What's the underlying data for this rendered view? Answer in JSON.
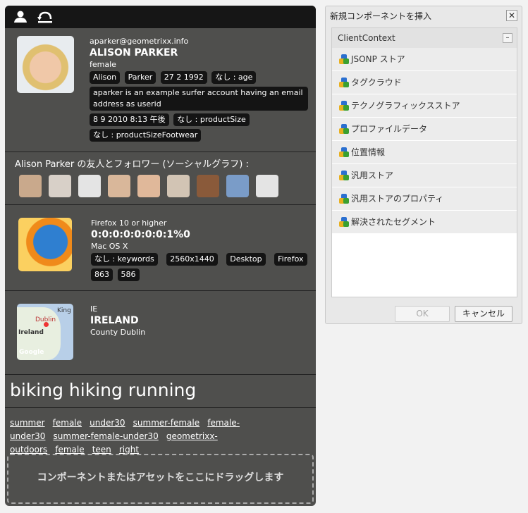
{
  "toolbar": {
    "icons": [
      "user-icon",
      "undo-icon"
    ]
  },
  "profile": {
    "email": "aparker@geometrixx.info",
    "name": "ALISON PARKER",
    "gender": "female",
    "chips": [
      "Alison",
      "Parker",
      "27 2 1992",
      "なし : age"
    ],
    "description": "aparker is an example surfer account having an email address as userid",
    "chips2": [
      "8 9 2010 8:13 午後",
      "なし : productSize",
      "なし : productSizeFootwear"
    ]
  },
  "social": {
    "title": "Alison Parker の友人とフォロワー (ソーシャルグラフ) :",
    "friend_count": 9
  },
  "browser": {
    "name": "Firefox 10 or higher",
    "ip": "0:0:0:0:0:0:0:1%0",
    "os": "Mac OS X",
    "chips": [
      "なし : keywords",
      "2560x1440",
      "Desktop",
      "Firefox",
      "863",
      "586"
    ]
  },
  "geo": {
    "code": "IE",
    "country": "IRELAND",
    "region": "County Dublin",
    "map_labels": [
      "Dublin",
      "Ireland",
      "King",
      "Google"
    ]
  },
  "interests": [
    "biking",
    "hiking",
    "running"
  ],
  "tags": [
    "summer",
    "female",
    "under30",
    "summer-female",
    "female-under30",
    "summer-female-under30",
    "geometrixx-outdoors",
    "female",
    "teen",
    "right"
  ],
  "dropzone": "コンポーネントまたはアセットをここにドラッグします",
  "dialog": {
    "title": "新規コンポーネントを挿入",
    "group": "ClientContext",
    "items": [
      "JSONP ストア",
      "タグクラウド",
      "テクノグラフィックスストア",
      "プロファイルデータ",
      "位置情報",
      "汎用ストア",
      "汎用ストアのプロパティ",
      "解決されたセグメント"
    ],
    "ok": "OK",
    "cancel": "キャンセル"
  }
}
